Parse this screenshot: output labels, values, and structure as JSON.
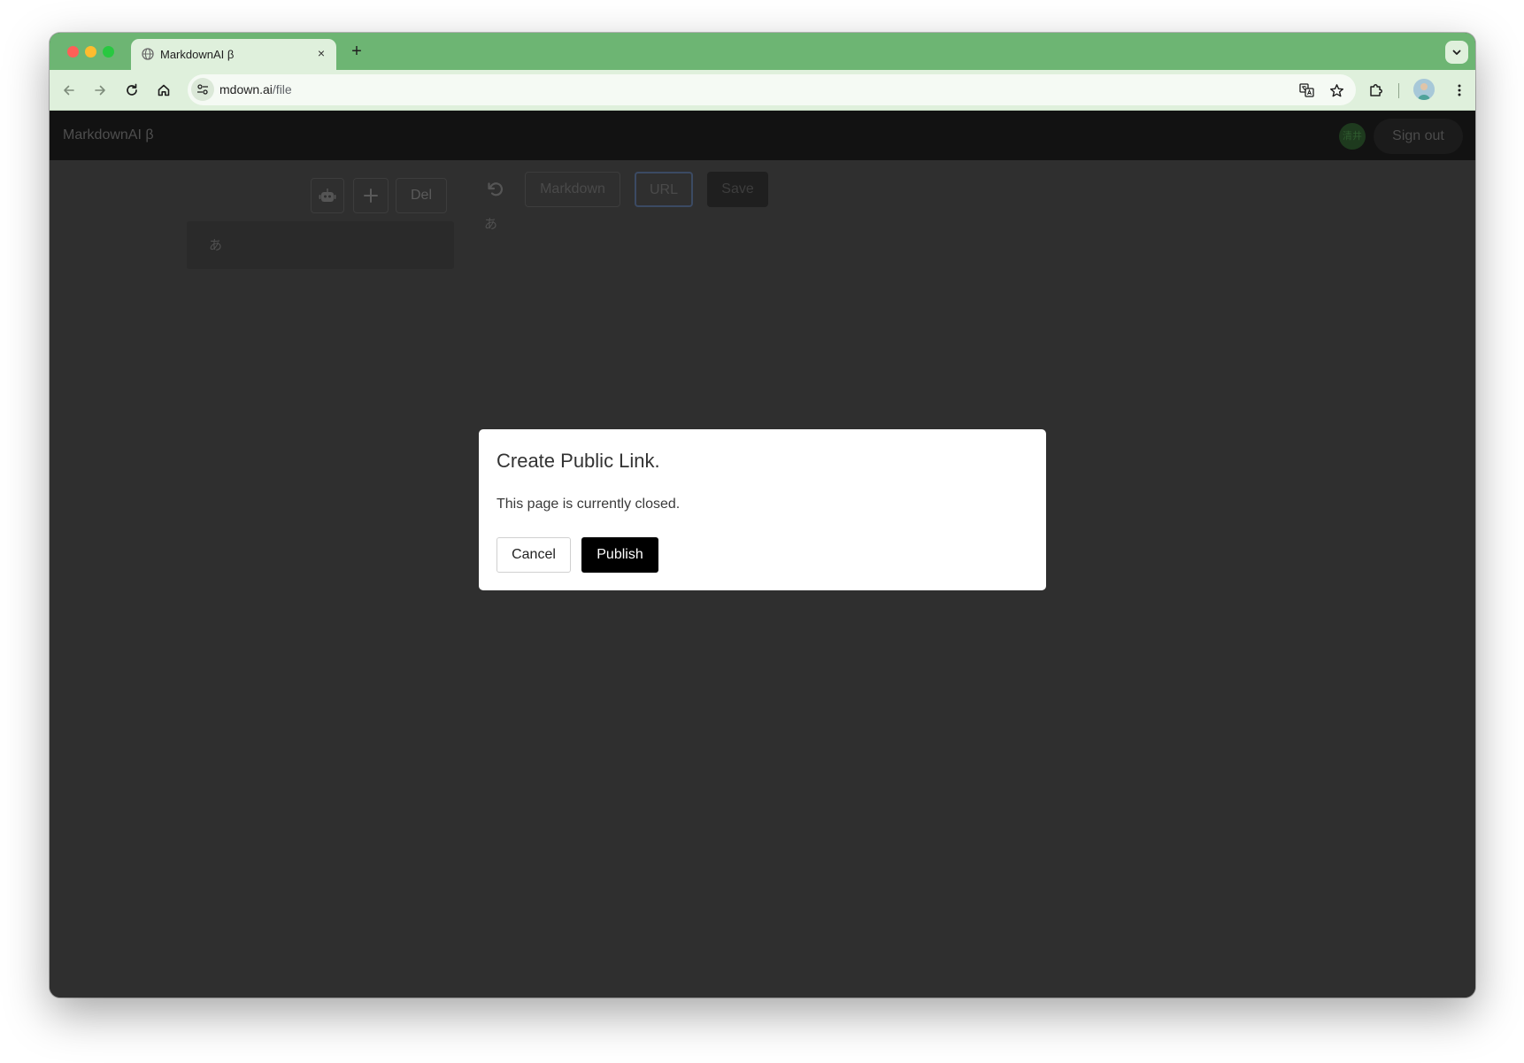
{
  "browser": {
    "tab_title": "MarkdownAI β",
    "tab_close": "×",
    "new_tab": "+",
    "url_host": "mdown.ai",
    "url_path": "/file",
    "accent_color": "#6db573"
  },
  "app": {
    "brand": "MarkdownAI β",
    "user_initials": "清井",
    "sign_out_label": "Sign out",
    "file_toolbar": {
      "delete_label": "Del"
    },
    "file_list": [
      {
        "label": "あ"
      }
    ],
    "editor_toolbar": {
      "markdown_label": "Markdown",
      "url_label": "URL",
      "save_label": "Save"
    },
    "editor_content": "あ"
  },
  "modal": {
    "title": "Create Public Link.",
    "body": "This page is currently closed.",
    "cancel_label": "Cancel",
    "publish_label": "Publish"
  }
}
